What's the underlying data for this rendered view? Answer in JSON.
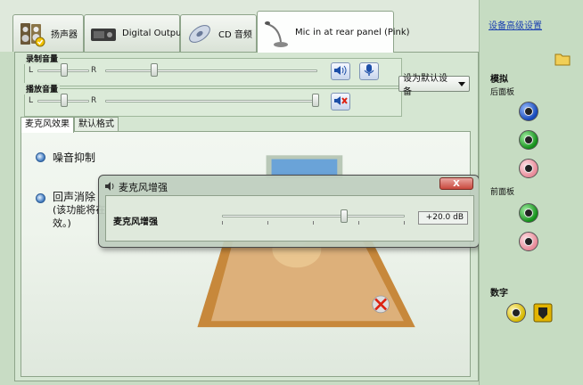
{
  "tabs": [
    {
      "label": "扬声器",
      "icon": "speaker-icon"
    },
    {
      "label": "Digital Output",
      "icon": "digital-output-icon"
    },
    {
      "label": "CD 音频",
      "icon": "cd-audio-icon"
    },
    {
      "label": "Mic in at rear panel (Pink)",
      "icon": "microphone-icon"
    }
  ],
  "record_volume": {
    "title": "录制音量",
    "left": "L",
    "right": "R",
    "balance": 0.5,
    "level": 0.22
  },
  "playback_volume": {
    "title": "播放音量",
    "left": "L",
    "right": "R",
    "balance": 0.5,
    "level": 1.0
  },
  "default_device_button": "设为默认设备",
  "inner_tabs": [
    "麦克风效果",
    "默认格式"
  ],
  "options": {
    "noise": "噪音抑制",
    "echo_title": "回声消除",
    "echo_note_line1": "(该功能将在",
    "echo_note_line2": "效。)"
  },
  "dialog": {
    "title": "麦克风增强",
    "close": "X",
    "label": "麦克风增强",
    "value": "+20.0 dB",
    "level": 0.67
  },
  "right_panel": {
    "advanced_link": "设备高级设置",
    "analog": "模拟",
    "rear": "后面板",
    "front": "前面板",
    "digital": "数字"
  },
  "colors": {
    "panel_bg": "#d5e6d2",
    "link": "#1a3fb0",
    "jack_blue": "#1447b8",
    "jack_green": "#128e18",
    "jack_pink": "#e78a98"
  }
}
